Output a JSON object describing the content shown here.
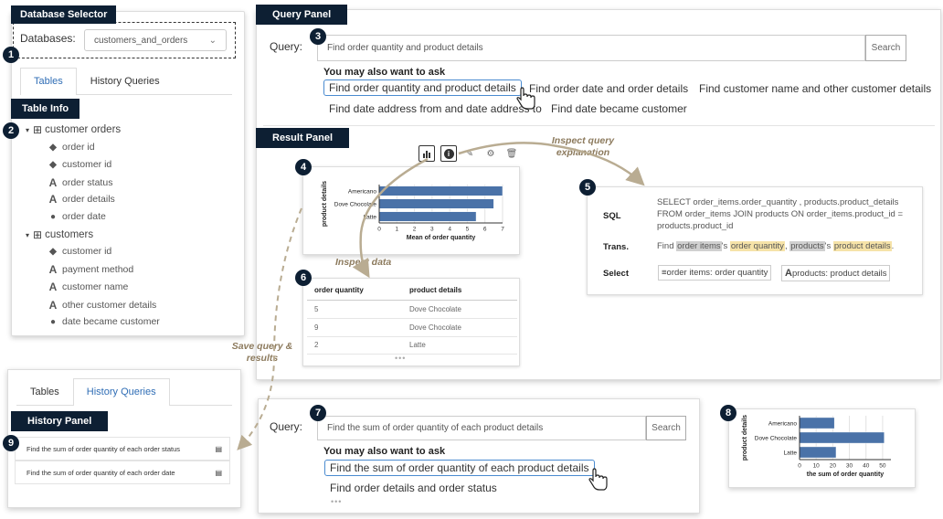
{
  "db_selector": {
    "tag": "Database Selector",
    "label": "Databases:",
    "value": "customers_and_orders",
    "chevron": "chevron-down-icon"
  },
  "left_tabs": [
    "Tables",
    "History Queries"
  ],
  "table_info": {
    "tag": "Table Info",
    "tables": [
      {
        "name": "customer orders",
        "columns": [
          {
            "name": "order id",
            "icon": "key-icon"
          },
          {
            "name": "customer id",
            "icon": "key-icon"
          },
          {
            "name": "order status",
            "icon": "text-type-icon"
          },
          {
            "name": "order details",
            "icon": "text-type-icon"
          },
          {
            "name": "order date",
            "icon": "clock-icon"
          }
        ]
      },
      {
        "name": "customers",
        "columns": [
          {
            "name": "customer id",
            "icon": "key-icon"
          },
          {
            "name": "payment method",
            "icon": "text-type-icon"
          },
          {
            "name": "customer name",
            "icon": "text-type-icon"
          },
          {
            "name": "other customer details",
            "icon": "text-type-icon"
          },
          {
            "name": "date became customer",
            "icon": "clock-icon"
          }
        ]
      }
    ]
  },
  "query_panel": {
    "tag": "Query Panel",
    "label": "Query:",
    "placeholder": "Find order quantity and product details",
    "search": "Search",
    "suggest_heading": "You may also want to ask",
    "suggestions": [
      "Find order quantity and product details",
      "Find order date and order details",
      "Find customer name and other customer details",
      "Find date address from and date address to",
      "Find date became customer"
    ]
  },
  "result_panel": {
    "tag": "Result Panel",
    "toolbar_icons": [
      "bar-chart-icon",
      "info-icon",
      "edit-icon",
      "settings-icon",
      "trash-icon"
    ]
  },
  "chart_data": [
    {
      "type": "bar",
      "orientation": "horizontal",
      "categories": [
        "Americano",
        "Dove Chocolate",
        "Latte"
      ],
      "values": [
        7,
        6.5,
        5.5
      ],
      "xlabel": "Mean of order quantity",
      "ylabel": "product details",
      "xlim": [
        0,
        7
      ],
      "ticks": [
        "0",
        "1",
        "2",
        "3",
        "4",
        "5",
        "6",
        "7"
      ],
      "color": "#4a72a8"
    },
    {
      "type": "bar",
      "orientation": "horizontal",
      "categories": [
        "Americano",
        "Dove Chocolate",
        "Latte"
      ],
      "values": [
        21,
        51,
        22
      ],
      "xlabel": "the sum of order quantity",
      "ylabel": "product details",
      "xlim": [
        0,
        55
      ],
      "ticks": [
        "0",
        "10",
        "20",
        "30",
        "40",
        "50"
      ],
      "color": "#4a72a8"
    }
  ],
  "data_table": {
    "headers": [
      "order quantity",
      "product details"
    ],
    "rows": [
      [
        "5",
        "Dove Chocolate"
      ],
      [
        "9",
        "Dove Chocolate"
      ],
      [
        "2",
        "Latte"
      ]
    ],
    "more": "•••"
  },
  "explanation": {
    "sql_label": "SQL",
    "sql": "SELECT order_items.order_quantity , products.product_details FROM order_items JOIN products ON order_items.product_id = products.product_id",
    "trans_label": "Trans.",
    "trans": {
      "p1": "Find ",
      "h1": "order items",
      "p2": "'s ",
      "h2": "order quantity",
      "p3": ", ",
      "h3": "products",
      "p4": "'s ",
      "h4": "product details",
      "p5": "."
    },
    "select_label": "Select",
    "select_chips": [
      "order items: order quantity",
      "products: product details"
    ]
  },
  "annotations": {
    "inspect_query": "Inspect query explanation",
    "inspect_data": "Inspect data",
    "save": "Save query & results"
  },
  "history": {
    "tabs": [
      "Tables",
      "History Queries"
    ],
    "tag": "History Panel",
    "items": [
      "Find the sum of order quantity of each order status",
      "Find the sum of order quantity of each order date"
    ]
  },
  "bottom_query": {
    "label": "Query:",
    "placeholder": "Find the sum of order quantity of each product details",
    "search": "Search",
    "suggest_heading": "You may also want to ask",
    "suggestions": [
      "Find the sum of order quantity of each product details",
      "Find order details and order status"
    ],
    "more": "•••"
  },
  "badges": [
    "1",
    "2",
    "3",
    "4",
    "5",
    "6",
    "7",
    "8",
    "9"
  ]
}
